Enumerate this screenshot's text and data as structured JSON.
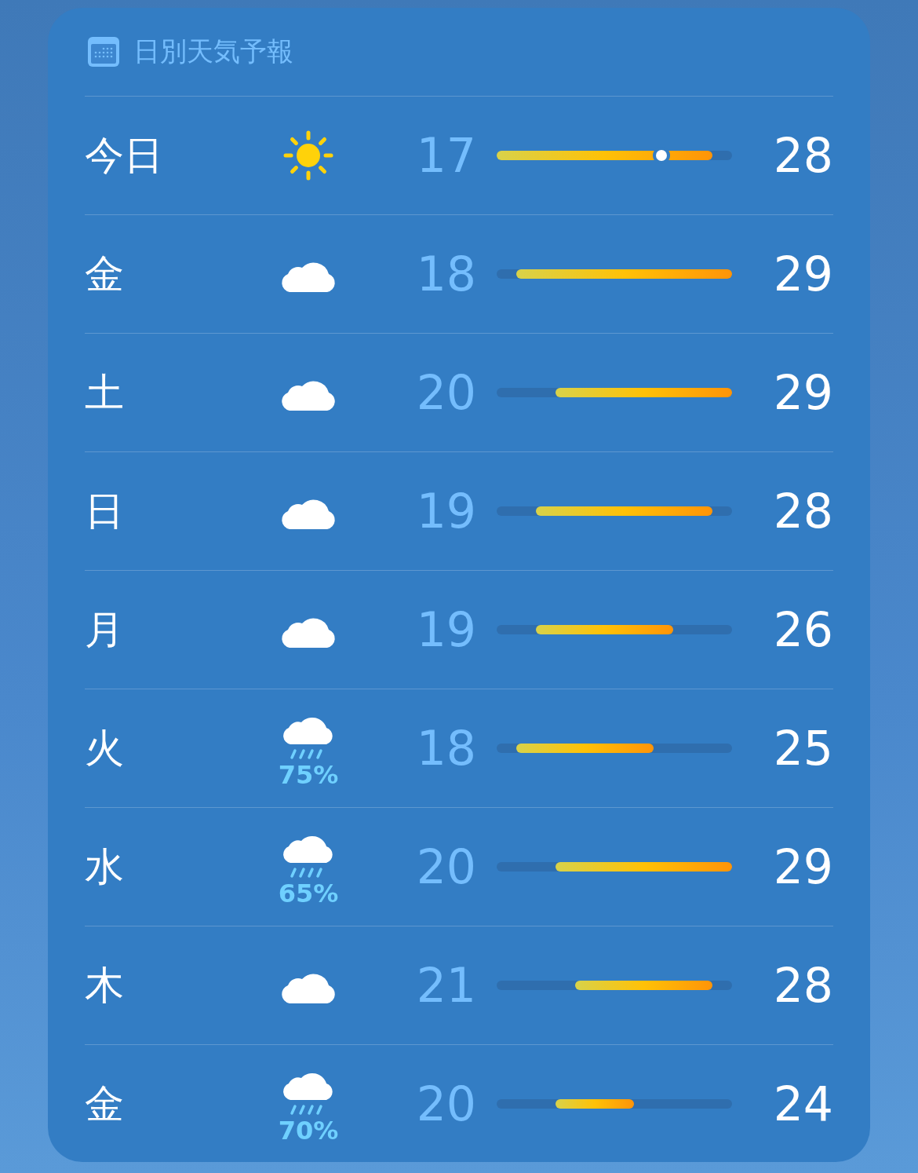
{
  "title": "日別天気予報",
  "days": [
    {
      "day": "今日",
      "kind": "sun",
      "low": "17",
      "high": "28",
      "now_marker": {
        "level": 0.7
      }
    },
    {
      "day": "金",
      "kind": "cloud",
      "low": "18",
      "high": "29"
    },
    {
      "day": "土",
      "kind": "cloud",
      "low": "20",
      "high": "29"
    },
    {
      "day": "日",
      "kind": "cloud",
      "low": "19",
      "high": "28"
    },
    {
      "day": "月",
      "kind": "cloud",
      "low": "19",
      "high": "26"
    },
    {
      "day": "火",
      "kind": "rain",
      "precip": "75%",
      "low": "18",
      "high": "25"
    },
    {
      "day": "水",
      "kind": "rain",
      "precip": "65%",
      "low": "20",
      "high": "29"
    },
    {
      "day": "木",
      "kind": "cloud",
      "low": "21",
      "high": "28"
    },
    {
      "day": "金",
      "kind": "rain",
      "precip": "70%",
      "low": "20",
      "high": "24"
    }
  ]
}
